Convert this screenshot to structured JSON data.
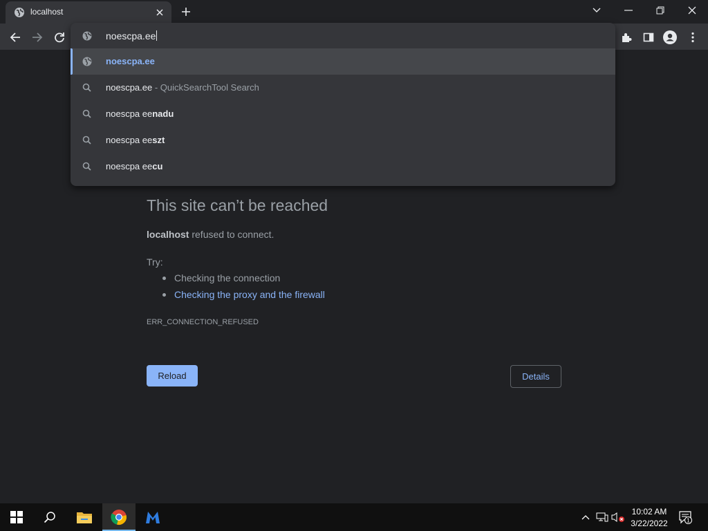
{
  "tab": {
    "title": "localhost"
  },
  "omnibox": {
    "value": "noescpa.ee",
    "suggestions": [
      {
        "plain": "noescpa.ee",
        "bold": "",
        "suffix": "",
        "icon": "globe-icon"
      },
      {
        "plain": "noescpa.ee",
        "bold": "",
        "suffix": " - QuickSearchTool Search",
        "icon": "search-icon"
      },
      {
        "plain": "noescpa ee",
        "bold": "nadu",
        "suffix": "",
        "icon": "search-icon"
      },
      {
        "plain": "noescpa ee",
        "bold": "szt",
        "suffix": "",
        "icon": "search-icon"
      },
      {
        "plain": "noescpa ee",
        "bold": "cu",
        "suffix": "",
        "icon": "search-icon"
      }
    ]
  },
  "error": {
    "title": "This site can’t be reached",
    "host": "localhost",
    "message": " refused to connect.",
    "try_label": "Try:",
    "tips": [
      "Checking the connection",
      "Checking the proxy and the firewall"
    ],
    "code": "ERR_CONNECTION_REFUSED",
    "reload_label": "Reload",
    "details_label": "Details"
  },
  "taskbar": {
    "time": "10:02 AM",
    "date": "3/22/2022",
    "notification_count": "1"
  },
  "colors": {
    "accent": "#8ab4f8",
    "background": "#202124",
    "toolbar": "#35363a"
  }
}
